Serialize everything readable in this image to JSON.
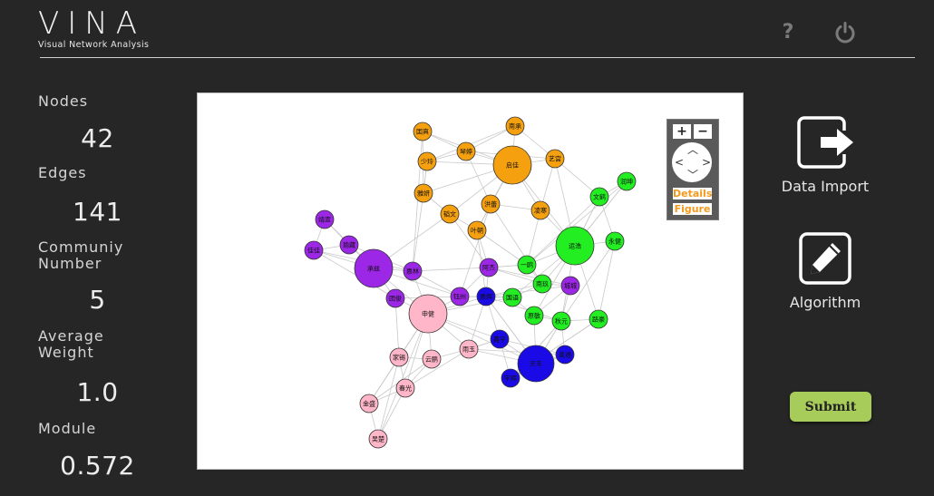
{
  "app": {
    "logo": "VINA",
    "subtitle": "Visual Network Analysis",
    "help_icon": "question-mark-icon",
    "power_icon": "power-icon"
  },
  "stats": [
    {
      "label": "Nodes",
      "value": "42"
    },
    {
      "label": "Edges",
      "value": "141"
    },
    {
      "label": "Communiy Number",
      "value": "5"
    },
    {
      "label": "Average Weight",
      "value": "1.0"
    },
    {
      "label": "Module",
      "value": "0.572"
    }
  ],
  "graph_controls": {
    "zoom_in": "+",
    "zoom_out": "−",
    "details": "Details",
    "figure": "Figure"
  },
  "actions": {
    "data_import": "Data Import",
    "algorithm": "Algorithm",
    "submit": "Submit"
  },
  "colors": {
    "orange": "#f5a00f",
    "green": "#22ee22",
    "purple": "#9c27e6",
    "pink": "#ffb6c8",
    "blue": "#1a0be6",
    "submit": "#a8cc5a"
  },
  "network": {
    "nodes": [
      {
        "id": "o1",
        "label": "囯真",
        "group": "orange",
        "size": "small"
      },
      {
        "id": "o2",
        "label": "南承",
        "group": "orange",
        "size": "small"
      },
      {
        "id": "o3",
        "label": "少玲",
        "group": "orange",
        "size": "small"
      },
      {
        "id": "o4",
        "label": "琴婷",
        "group": "orange",
        "size": "small"
      },
      {
        "id": "o5",
        "label": "启佳",
        "group": "orange",
        "size": "large"
      },
      {
        "id": "o6",
        "label": "艺宫",
        "group": "orange",
        "size": "small"
      },
      {
        "id": "o7",
        "label": "雅妍",
        "group": "orange",
        "size": "small"
      },
      {
        "id": "o8",
        "label": "洪蕾",
        "group": "orange",
        "size": "small"
      },
      {
        "id": "o9",
        "label": "韬文",
        "group": "orange",
        "size": "small"
      },
      {
        "id": "o10",
        "label": "凌寒",
        "group": "orange",
        "size": "small"
      },
      {
        "id": "o11",
        "label": "叶朝",
        "group": "orange",
        "size": "small"
      },
      {
        "id": "g1",
        "label": "润坤",
        "group": "green",
        "size": "small"
      },
      {
        "id": "g2",
        "label": "文鹤",
        "group": "green",
        "size": "small"
      },
      {
        "id": "g3",
        "label": "运浩",
        "group": "green",
        "size": "large"
      },
      {
        "id": "g4",
        "label": "永健",
        "group": "green",
        "size": "small"
      },
      {
        "id": "g5",
        "label": "一鸥",
        "group": "green",
        "size": "small"
      },
      {
        "id": "g6",
        "label": "南玖",
        "group": "green",
        "size": "small"
      },
      {
        "id": "g7",
        "label": "国语",
        "group": "green",
        "size": "small"
      },
      {
        "id": "g8",
        "label": "原敏",
        "group": "green",
        "size": "small"
      },
      {
        "id": "g9",
        "label": "秋元",
        "group": "green",
        "size": "small"
      },
      {
        "id": "g10",
        "label": "路豪",
        "group": "green",
        "size": "small"
      },
      {
        "id": "p1",
        "label": "靖宣",
        "group": "purple",
        "size": "small"
      },
      {
        "id": "p2",
        "label": "瑜藏",
        "group": "purple",
        "size": "small"
      },
      {
        "id": "p3",
        "label": "佳佳",
        "group": "purple",
        "size": "small"
      },
      {
        "id": "p4",
        "label": "承兹",
        "group": "purple",
        "size": "large"
      },
      {
        "id": "p5",
        "label": "嘉林",
        "group": "purple",
        "size": "small"
      },
      {
        "id": "p6",
        "label": "阿杰",
        "group": "purple",
        "size": "small"
      },
      {
        "id": "p7",
        "label": "团俊",
        "group": "purple",
        "size": "small"
      },
      {
        "id": "p8",
        "label": "钰州",
        "group": "purple",
        "size": "small"
      },
      {
        "id": "p9",
        "label": "城城",
        "group": "purple",
        "size": "small"
      },
      {
        "id": "k1",
        "label": "申健",
        "group": "pink",
        "size": "large"
      },
      {
        "id": "k2",
        "label": "家锡",
        "group": "pink",
        "size": "small"
      },
      {
        "id": "k3",
        "label": "云鹏",
        "group": "pink",
        "size": "small"
      },
      {
        "id": "k4",
        "label": "雨玉",
        "group": "pink",
        "size": "small"
      },
      {
        "id": "k5",
        "label": "春光",
        "group": "pink",
        "size": "small"
      },
      {
        "id": "k6",
        "label": "金盛",
        "group": "pink",
        "size": "small"
      },
      {
        "id": "k7",
        "label": "吴楚",
        "group": "pink",
        "size": "small"
      },
      {
        "id": "b1",
        "label": "嘉辉",
        "group": "blue",
        "size": "small"
      },
      {
        "id": "b2",
        "label": "鑫宇",
        "group": "blue",
        "size": "small"
      },
      {
        "id": "b3",
        "label": "天丰",
        "group": "blue",
        "size": "large"
      },
      {
        "id": "b4",
        "label": "奥通",
        "group": "blue",
        "size": "small"
      },
      {
        "id": "b5",
        "label": "宇辉",
        "group": "blue",
        "size": "small"
      }
    ],
    "edges": [
      [
        "o1",
        "o5"
      ],
      [
        "o2",
        "o5"
      ],
      [
        "o3",
        "o5"
      ],
      [
        "o4",
        "o5"
      ],
      [
        "o6",
        "o5"
      ],
      [
        "o7",
        "o5"
      ],
      [
        "o8",
        "o5"
      ],
      [
        "o9",
        "o5"
      ],
      [
        "o10",
        "o5"
      ],
      [
        "o11",
        "o5"
      ],
      [
        "o1",
        "o4"
      ],
      [
        "o3",
        "o4"
      ],
      [
        "o2",
        "o6"
      ],
      [
        "o8",
        "o10"
      ],
      [
        "o9",
        "o11"
      ],
      [
        "o7",
        "o9"
      ],
      [
        "o7",
        "o3"
      ],
      [
        "o4",
        "o8"
      ],
      [
        "o6",
        "o10"
      ],
      [
        "o11",
        "o8"
      ],
      [
        "o7",
        "p5"
      ],
      [
        "o9",
        "p4"
      ],
      [
        "o11",
        "p6"
      ],
      [
        "o5",
        "g3"
      ],
      [
        "o10",
        "g3"
      ],
      [
        "o6",
        "g2"
      ],
      [
        "o8",
        "p8"
      ],
      [
        "o11",
        "b1"
      ],
      [
        "o1",
        "o7"
      ],
      [
        "o2",
        "o4"
      ],
      [
        "g3",
        "g1"
      ],
      [
        "g3",
        "g2"
      ],
      [
        "g3",
        "g4"
      ],
      [
        "g3",
        "g5"
      ],
      [
        "g3",
        "g6"
      ],
      [
        "g3",
        "g7"
      ],
      [
        "g3",
        "g8"
      ],
      [
        "g3",
        "g9"
      ],
      [
        "g3",
        "g10"
      ],
      [
        "g1",
        "g2"
      ],
      [
        "g5",
        "g6"
      ],
      [
        "g6",
        "g7"
      ],
      [
        "g7",
        "g8"
      ],
      [
        "g8",
        "g9"
      ],
      [
        "g9",
        "g10"
      ],
      [
        "g2",
        "g5"
      ],
      [
        "g4",
        "g10"
      ],
      [
        "g6",
        "p9"
      ],
      [
        "g7",
        "b1"
      ],
      [
        "g8",
        "b3"
      ],
      [
        "g5",
        "p6"
      ],
      [
        "g7",
        "k1"
      ],
      [
        "g9",
        "b5"
      ],
      [
        "g2",
        "g4"
      ],
      [
        "g1",
        "g3"
      ],
      [
        "p4",
        "p1"
      ],
      [
        "p4",
        "p2"
      ],
      [
        "p4",
        "p3"
      ],
      [
        "p4",
        "p5"
      ],
      [
        "p4",
        "p7"
      ],
      [
        "p4",
        "k1"
      ],
      [
        "p5",
        "p6"
      ],
      [
        "p5",
        "p8"
      ],
      [
        "p6",
        "p9"
      ],
      [
        "p6",
        "p8"
      ],
      [
        "p1",
        "p2"
      ],
      [
        "p2",
        "p3"
      ],
      [
        "p7",
        "k1"
      ],
      [
        "p8",
        "k1"
      ],
      [
        "p6",
        "g6"
      ],
      [
        "p9",
        "g8"
      ],
      [
        "p9",
        "b1"
      ],
      [
        "p5",
        "k1"
      ],
      [
        "p3",
        "p5"
      ],
      [
        "p7",
        "p8"
      ],
      [
        "p6",
        "b1"
      ],
      [
        "p8",
        "b1"
      ],
      [
        "p4",
        "p8"
      ],
      [
        "p1",
        "p3"
      ],
      [
        "p6",
        "g5"
      ],
      [
        "k1",
        "k2"
      ],
      [
        "k1",
        "k3"
      ],
      [
        "k1",
        "k4"
      ],
      [
        "k1",
        "k5"
      ],
      [
        "k1",
        "k6"
      ],
      [
        "k1",
        "k7"
      ],
      [
        "k1",
        "b1"
      ],
      [
        "k1",
        "b2"
      ],
      [
        "k2",
        "k3"
      ],
      [
        "k2",
        "k5"
      ],
      [
        "k3",
        "k4"
      ],
      [
        "k5",
        "k6"
      ],
      [
        "k6",
        "k7"
      ],
      [
        "k5",
        "k7"
      ],
      [
        "k4",
        "b3"
      ],
      [
        "k3",
        "k5"
      ],
      [
        "k4",
        "b2"
      ],
      [
        "k2",
        "k6"
      ],
      [
        "k1",
        "b3"
      ],
      [
        "k4",
        "b1"
      ],
      [
        "b3",
        "b1"
      ],
      [
        "b3",
        "b2"
      ],
      [
        "b3",
        "b4"
      ],
      [
        "b3",
        "b5"
      ],
      [
        "b1",
        "b2"
      ],
      [
        "b2",
        "b4"
      ],
      [
        "b4",
        "b5"
      ],
      [
        "b1",
        "g9"
      ],
      [
        "b5",
        "g10"
      ],
      [
        "b2",
        "k4"
      ],
      [
        "b1",
        "b3"
      ],
      [
        "b5",
        "g9"
      ],
      [
        "b4",
        "k4"
      ],
      [
        "b3",
        "g9"
      ],
      [
        "b1",
        "g6"
      ],
      [
        "o1",
        "p5"
      ],
      [
        "o3",
        "o7"
      ],
      [
        "o9",
        "p6"
      ],
      [
        "o11",
        "g5"
      ],
      [
        "o10",
        "g5"
      ],
      [
        "o8",
        "g6"
      ],
      [
        "o5",
        "o8"
      ],
      [
        "o4",
        "o6"
      ],
      [
        "o2",
        "o3"
      ],
      [
        "o6",
        "g3"
      ],
      [
        "g2",
        "g3"
      ],
      [
        "g4",
        "g9"
      ],
      [
        "g10",
        "b5"
      ],
      [
        "g1",
        "g5"
      ],
      [
        "g9",
        "b3"
      ],
      [
        "p2",
        "p5"
      ],
      [
        "p1",
        "p4"
      ],
      [
        "p7",
        "k2"
      ],
      [
        "k2",
        "k7"
      ],
      [
        "k3",
        "k6"
      ],
      [
        "k4",
        "k5"
      ],
      [
        "b2",
        "b5"
      ],
      [
        "b4",
        "g9"
      ],
      [
        "p3",
        "p7"
      ],
      [
        "p8",
        "g7"
      ],
      [
        "p9",
        "g9"
      ]
    ]
  }
}
